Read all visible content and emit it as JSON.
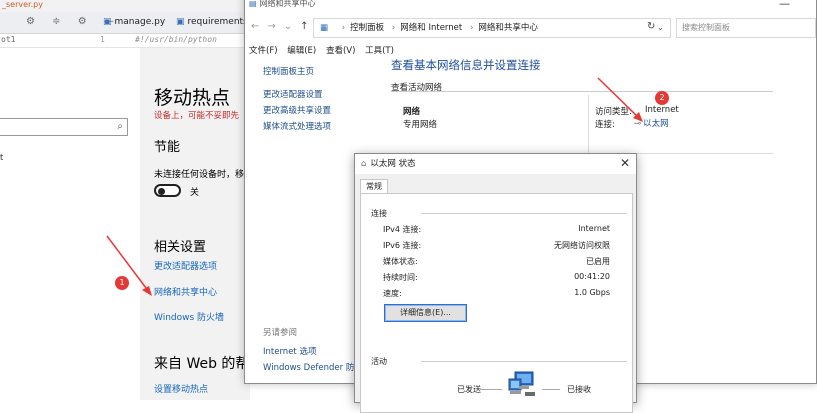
{
  "ide": {
    "title": "_server.py",
    "tools": "⚙ ≑ ⚙ —",
    "tabs": [
      "manage.py",
      "requirements."
    ],
    "project": "ot1",
    "line_no": "1",
    "code": "#!/usr/bin/python",
    "side_mark": "t"
  },
  "settings": {
    "title": "移动热点",
    "warning": "设备上，可能不妥即先",
    "section_energy": "节能",
    "energy_desc": "未连接任何设备时，移",
    "toggle_state": "关",
    "section_related": "相关设置",
    "links": [
      "更改适配器选项",
      "网络和共享中心",
      "Windows 防火墙"
    ],
    "section_web": "来自 Web 的帮助",
    "web_link": "设置移动热点"
  },
  "network_center": {
    "window_title": "网络和共享中心",
    "breadcrumb": [
      "控制面板",
      "网络和 Internet",
      "网络和共享中心"
    ],
    "search_placeholder": "搜索控制面板",
    "menu": [
      "文件(F)",
      "编辑(E)",
      "查看(V)",
      "工具(T)"
    ],
    "sidebar_home": "控制面板主页",
    "sidebar_links": [
      "更改适配器设置",
      "更改高级共享设置",
      "媒体流式处理选项"
    ],
    "see_also_label": "另请参阅",
    "see_also_links": [
      "Internet 选项",
      "Windows Defender 防火"
    ],
    "main_title": "查看基本网络信息并设置连接",
    "active_networks_label": "查看活动网络",
    "network_name": "网络",
    "network_type": "专用网络",
    "access_type_label": "访问类型:",
    "access_type_value": "Internet",
    "connections_label": "连接:",
    "connections_value": "以太网"
  },
  "status_dialog": {
    "title": "以太网 状态",
    "tab": "常规",
    "connection_group": "连接",
    "rows": [
      {
        "label": "IPv4 连接:",
        "value": "Internet"
      },
      {
        "label": "IPv6 连接:",
        "value": "无网络访问权限"
      },
      {
        "label": "媒体状态:",
        "value": "已启用"
      },
      {
        "label": "持续时间:",
        "value": "00:41:20"
      },
      {
        "label": "速度:",
        "value": "1.0 Gbps"
      }
    ],
    "details_button": "详细信息(E)...",
    "activity_group": "活动",
    "sent_label": "已发送",
    "received_label": "已接收"
  },
  "annotations": {
    "badge_1": "1",
    "badge_2": "2",
    "color": "#e53935"
  }
}
